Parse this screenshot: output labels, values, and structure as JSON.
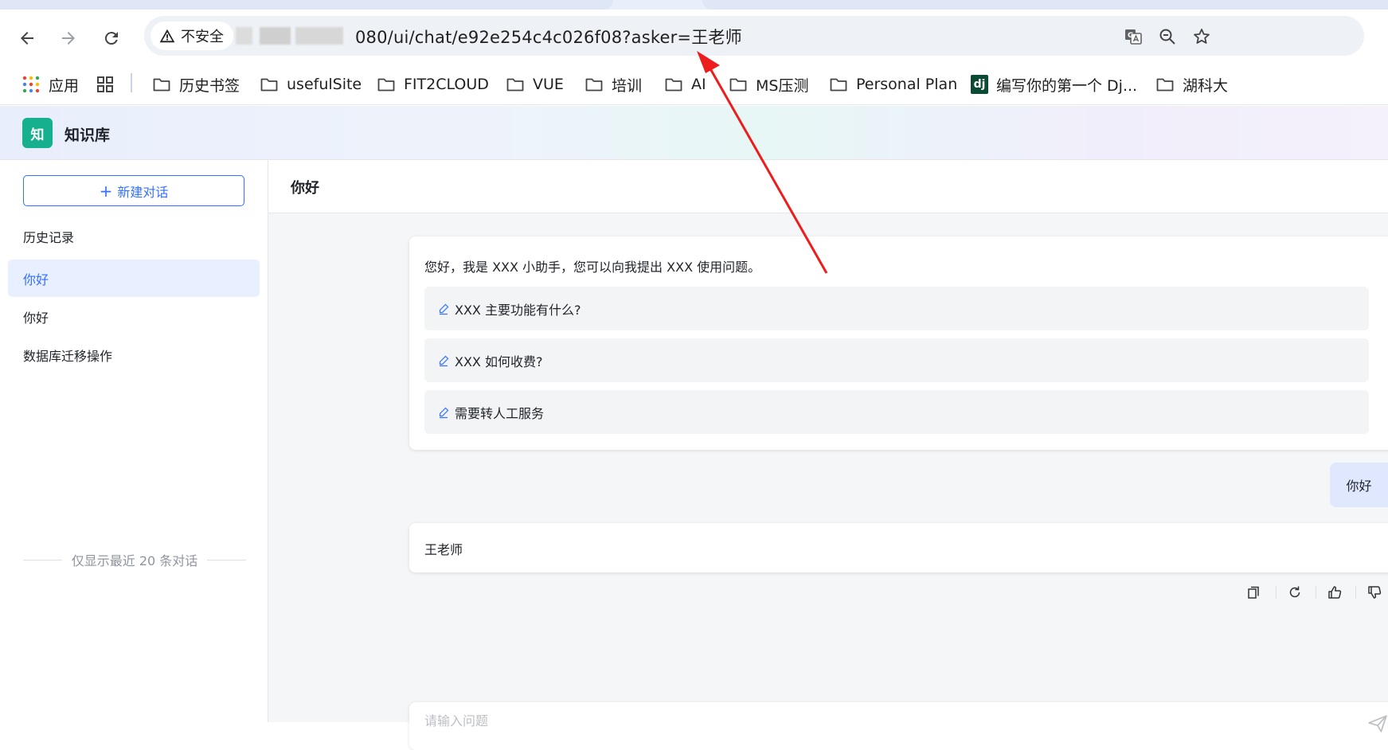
{
  "browser": {
    "security_label": "不安全",
    "url_visible": "080/ui/chat/e92e254c4c026f08?asker=王老师",
    "nav": {
      "back_icon": "arrow-left-icon",
      "forward_icon": "arrow-right-icon",
      "reload_icon": "reload-icon"
    },
    "omnibox_icons": [
      "translate-icon",
      "zoom-icon",
      "star-icon"
    ],
    "bookmarks": {
      "apps_label": "应用",
      "items": [
        {
          "label": "历史书签"
        },
        {
          "label": "usefulSite"
        },
        {
          "label": "FIT2CLOUD"
        },
        {
          "label": "VUE"
        },
        {
          "label": "培训"
        },
        {
          "label": "AI"
        },
        {
          "label": "MS压测"
        },
        {
          "label": "Personal Plan"
        },
        {
          "label": "编写你的第一个 Dj..."
        },
        {
          "label": "湖科大"
        }
      ],
      "dj_logo_text": "dj"
    }
  },
  "app": {
    "logo_text": "知",
    "title": "知识库"
  },
  "sidebar": {
    "new_chat_label": "新建对话",
    "history_title": "历史记录",
    "history_items": [
      "你好",
      "你好",
      "数据库迁移操作"
    ],
    "history_note": "仅显示最近 20 条对话"
  },
  "chat": {
    "title": "你好",
    "welcome_text": "您好，我是 XXX 小助手，您可以向我提出 XXX 使用问题。",
    "suggestions": [
      "XXX 主要功能有什么?",
      "XXX 如何收费?",
      "需要转人工服务"
    ],
    "user_message": "你好",
    "answer_text": "王老师",
    "input_placeholder": "请输入问题",
    "action_icons": [
      "copy-icon",
      "regenerate-icon",
      "thumbs-up-icon",
      "thumbs-down-icon"
    ]
  },
  "colors": {
    "accent": "#3370ff",
    "logo_green": "#16b08f",
    "annotation_red": "#ee1d1d"
  }
}
